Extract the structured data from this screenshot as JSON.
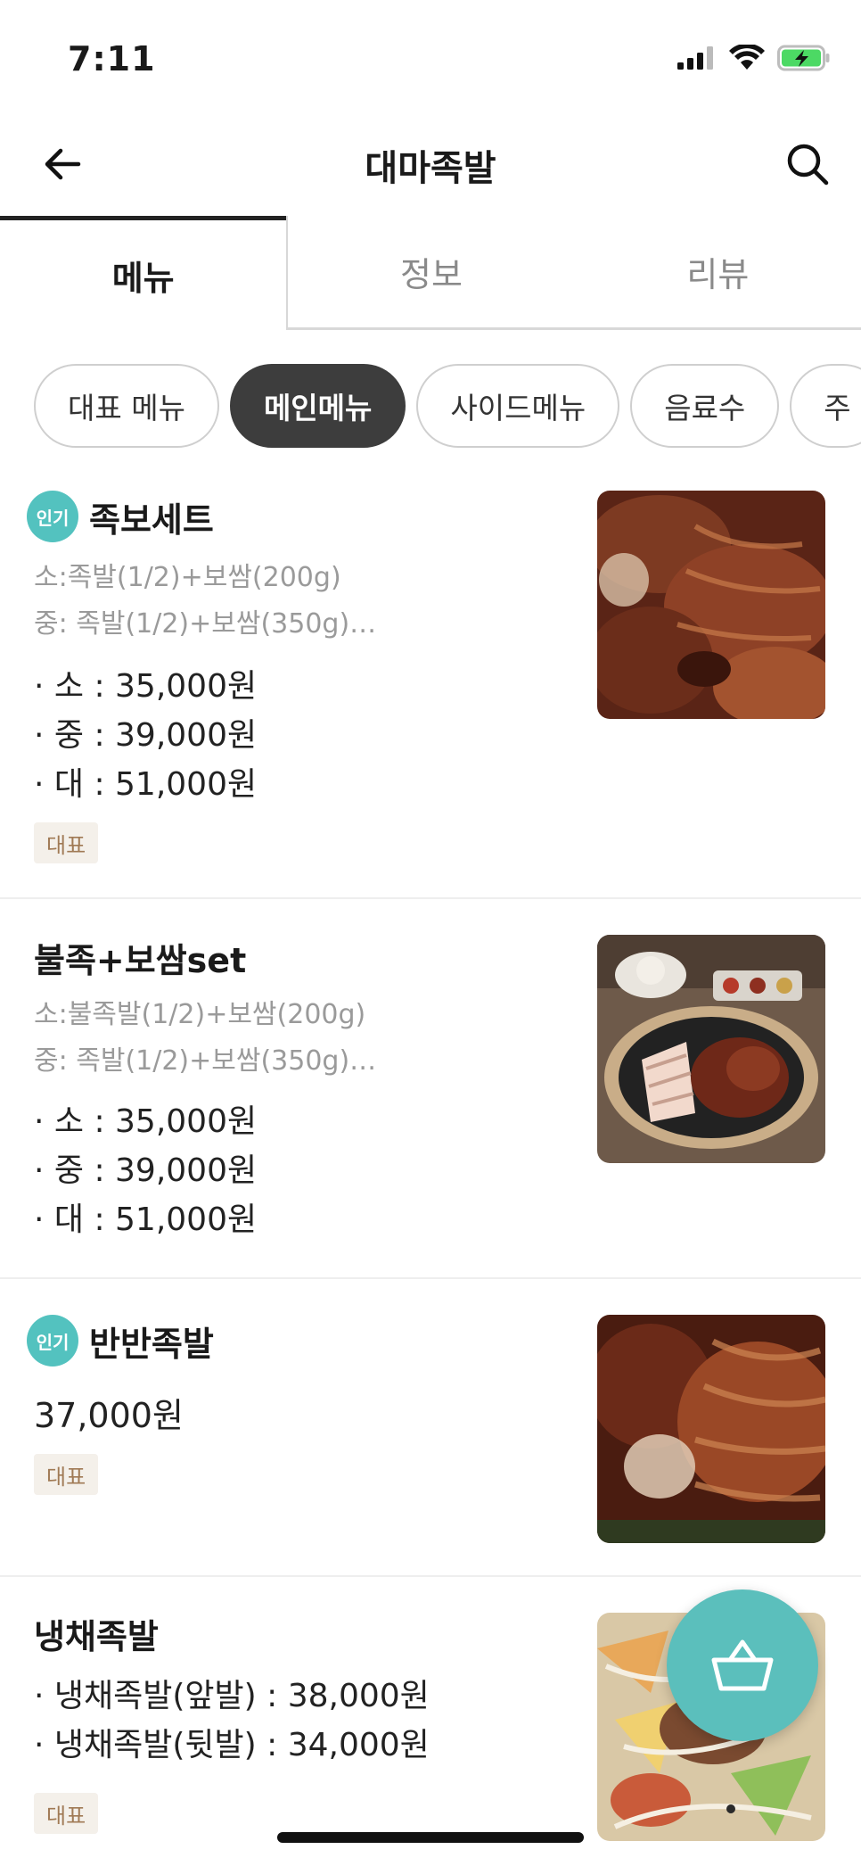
{
  "status_bar": {
    "time": "7:11"
  },
  "header": {
    "title": "대마족발",
    "back_icon": "arrow-left-icon",
    "search_icon": "search-icon"
  },
  "tabs": [
    {
      "label": "메뉴",
      "active": true
    },
    {
      "label": "정보",
      "active": false
    },
    {
      "label": "리뷰",
      "active": false
    }
  ],
  "categories": [
    {
      "label": "대표 메뉴",
      "selected": false
    },
    {
      "label": "메인메뉴",
      "selected": true
    },
    {
      "label": "사이드메뉴",
      "selected": false
    },
    {
      "label": "음료수",
      "selected": false
    },
    {
      "label": "주",
      "selected": false
    }
  ],
  "menu_items": [
    {
      "popular_badge": "인기",
      "name": "족보세트",
      "desc_lines": [
        "소:족발(1/2)+보쌈(200g)",
        "중: 족발(1/2)+보쌈(350g)…"
      ],
      "prices": [
        "· 소 : 35,000원",
        "· 중 : 39,000원",
        "· 대 : 51,000원"
      ],
      "tag": "대표"
    },
    {
      "name": "불족+보쌈set",
      "desc_lines": [
        "소:불족발(1/2)+보쌈(200g)",
        "중: 족발(1/2)+보쌈(350g)…"
      ],
      "prices": [
        "· 소 : 35,000원",
        "· 중 : 39,000원",
        "· 대 : 51,000원"
      ]
    },
    {
      "popular_badge": "인기",
      "name": "반반족발",
      "price": "37,000원",
      "tag": "대표"
    },
    {
      "name": "냉채족발",
      "prices": [
        "· 냉채족발(앞발) : 38,000원",
        "· 냉채족발(뒷발) : 34,000원"
      ],
      "tag": "대표"
    }
  ],
  "colors": {
    "accent": "#5bbfbc",
    "badge": "#53c2bf",
    "chip_selected": "#3d3d3d",
    "tag_bg": "#f4f0ea",
    "tag_text": "#a07a55"
  },
  "fab": {
    "icon": "shopping-basket-icon"
  }
}
